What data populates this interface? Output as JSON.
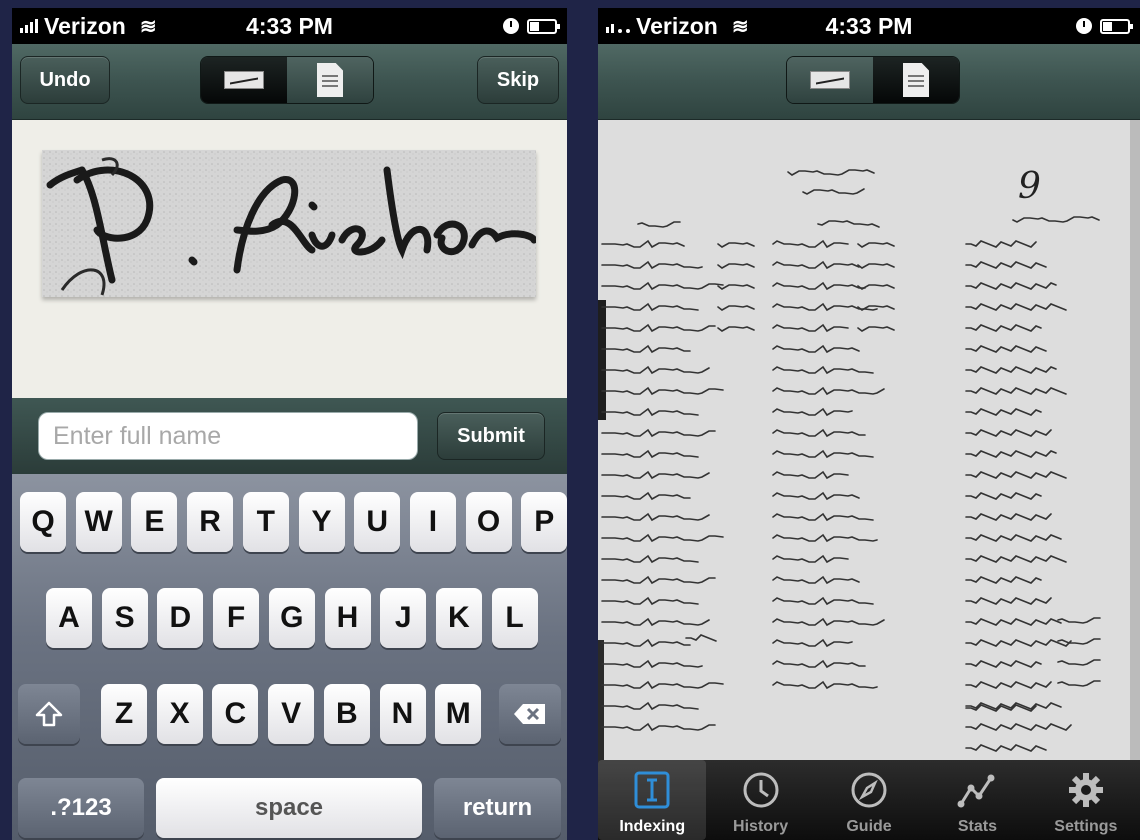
{
  "left_screen": {
    "status_bar": {
      "carrier": "Verizon",
      "time": "4:33 PM"
    },
    "toolbar": {
      "undo_label": "Undo",
      "skip_label": "Skip"
    },
    "name_input": {
      "placeholder": "Enter full name",
      "value": ""
    },
    "submit_label": "Submit",
    "keyboard": {
      "row1": [
        "Q",
        "W",
        "E",
        "R",
        "T",
        "Y",
        "U",
        "I",
        "O",
        "P"
      ],
      "row2": [
        "A",
        "S",
        "D",
        "F",
        "G",
        "H",
        "J",
        "K",
        "L"
      ],
      "row3": [
        "Z",
        "X",
        "C",
        "V",
        "B",
        "N",
        "M"
      ],
      "numbers_label": ".?123",
      "space_label": "space",
      "return_label": "return"
    }
  },
  "right_screen": {
    "status_bar": {
      "carrier": "Verizon",
      "time": "4:33 PM"
    },
    "document_page_mark": "9",
    "tabs": [
      {
        "label": "Indexing",
        "icon": "indexing-icon",
        "active": true
      },
      {
        "label": "History",
        "icon": "clock-icon",
        "active": false
      },
      {
        "label": "Guide",
        "icon": "compass-icon",
        "active": false
      },
      {
        "label": "Stats",
        "icon": "stats-icon",
        "active": false
      },
      {
        "label": "Settings",
        "icon": "gear-icon",
        "active": false
      }
    ]
  },
  "colors": {
    "page_background": "#1f2447",
    "toolbar": "#3d5450",
    "active_tab_icon": "#2f8ed8"
  }
}
